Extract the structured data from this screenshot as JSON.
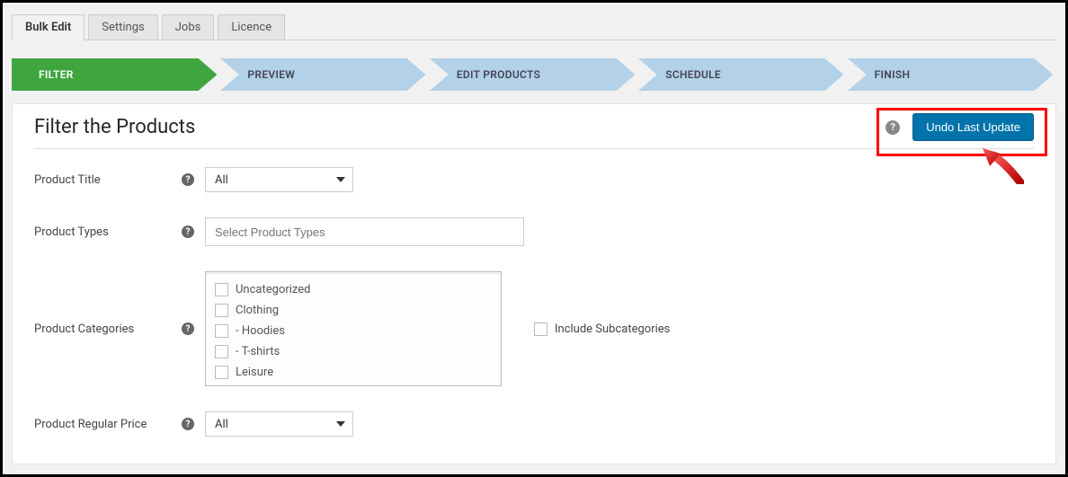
{
  "tabs": [
    {
      "label": "Bulk Edit",
      "active": true
    },
    {
      "label": "Settings",
      "active": false
    },
    {
      "label": "Jobs",
      "active": false
    },
    {
      "label": "Licence",
      "active": false
    }
  ],
  "steps": [
    {
      "label": "FILTER",
      "active": true
    },
    {
      "label": "PREVIEW",
      "active": false
    },
    {
      "label": "EDIT PRODUCTS",
      "active": false
    },
    {
      "label": "SCHEDULE",
      "active": false
    },
    {
      "label": "FINISH",
      "active": false
    }
  ],
  "panel": {
    "title": "Filter the Products",
    "undo_label": "Undo Last Update"
  },
  "rows": {
    "title": {
      "label": "Product Title",
      "value": "All"
    },
    "types": {
      "label": "Product Types",
      "placeholder": "Select Product Types"
    },
    "categories": {
      "label": "Product Categories",
      "items": [
        "Uncategorized",
        "Clothing",
        "- Hoodies",
        "- T-shirts",
        "Leisure"
      ],
      "include_sub_label": "Include Subcategories"
    },
    "regular_price": {
      "label": "Product Regular Price",
      "value": "All"
    }
  }
}
